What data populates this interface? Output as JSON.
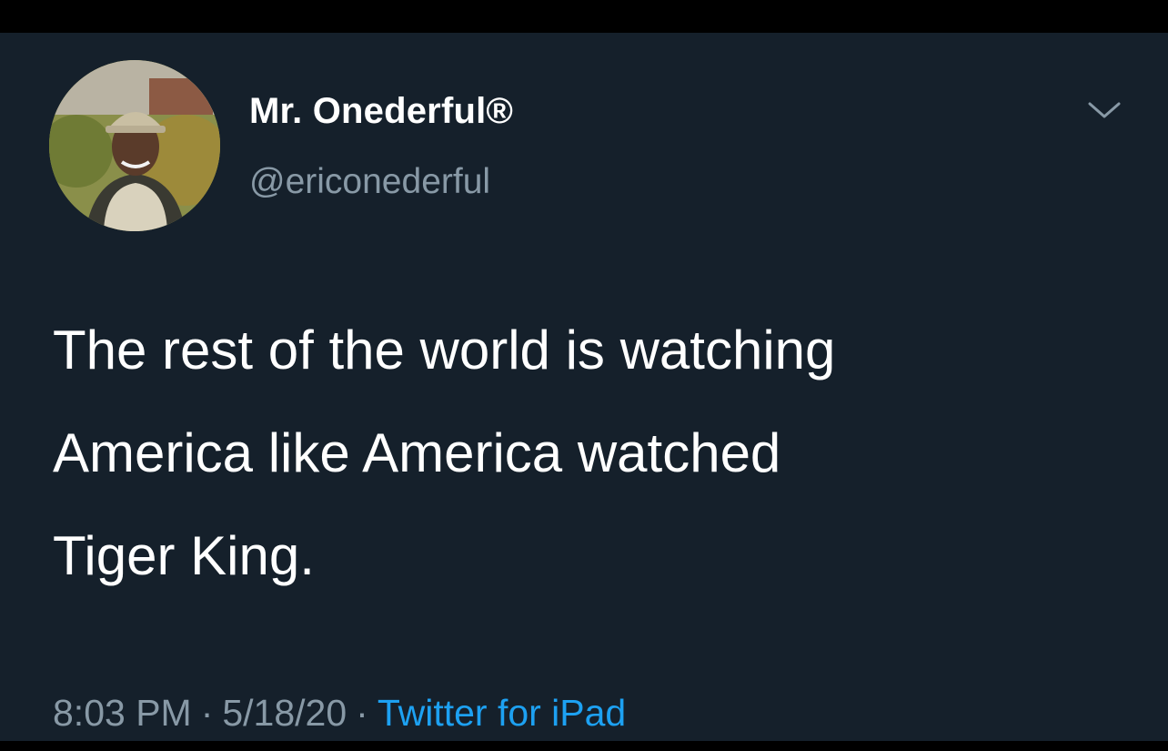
{
  "tweet": {
    "display_name": "Mr. Onederful®",
    "handle": "@ericonederful",
    "text_lines": [
      "The rest of the world is watching",
      "America like America watched",
      "Tiger King."
    ],
    "time": "8:03 PM",
    "date": "5/18/20",
    "separator": "·",
    "source": "Twitter for iPad",
    "more_icon": "chevron-down-icon",
    "avatar_icon": "avatar"
  },
  "colors": {
    "background": "#15202b",
    "text_primary": "#ffffff",
    "text_secondary": "#8899a6",
    "link": "#1da1f2"
  }
}
